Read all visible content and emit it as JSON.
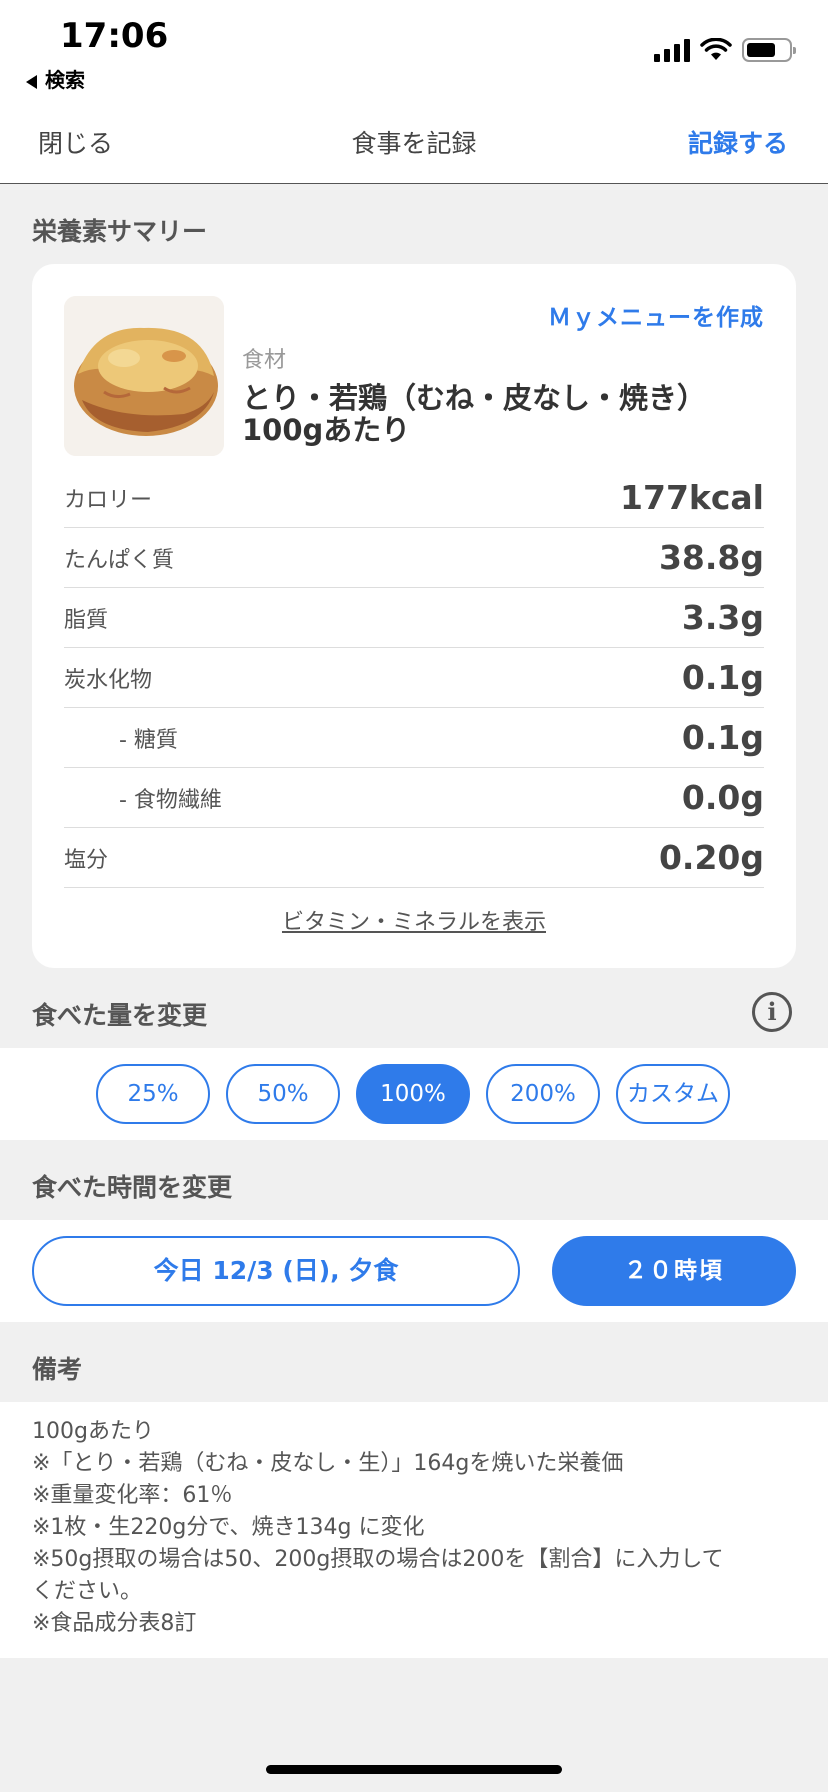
{
  "status_bar": {
    "time": "17:06",
    "back_label": "検索"
  },
  "nav": {
    "close": "閉じる",
    "title": "食事を記録",
    "record": "記録する"
  },
  "summary": {
    "section_title": "栄養素サマリー",
    "my_menu_link": "Ｍｙメニューを作成",
    "category": "食材",
    "food_name_line1": "とり・若鶏（むね・皮なし・焼き）",
    "food_name_line2": "100gあたり",
    "rows": [
      {
        "label": "カロリー",
        "value": "177kcal"
      },
      {
        "label": "たんぱく質",
        "value": "38.8g"
      },
      {
        "label": "脂質",
        "value": "3.3g"
      },
      {
        "label": "炭水化物",
        "value": "0.1g"
      },
      {
        "label": "- 糖質",
        "value": "0.1g"
      },
      {
        "label": "- 食物繊維",
        "value": "0.0g"
      },
      {
        "label": "塩分",
        "value": "0.20g"
      }
    ],
    "vitamin_link": "ビタミン・ミネラルを表示"
  },
  "amount": {
    "section_title": "食べた量を変更",
    "options": [
      "25%",
      "50%",
      "100%",
      "200%",
      "カスタム"
    ],
    "selected": "100%"
  },
  "time": {
    "section_title": "食べた時間を変更",
    "date": "今日 12/3 (日), 夕食",
    "hour": "２０時頃"
  },
  "notes": {
    "section_title": "備考",
    "lines": [
      "100gあたり",
      "※「とり・若鶏（むね・皮なし・生）」164gを焼いた栄養価",
      "※重量変化率：61％",
      "※1枚・生220g分で、焼き134g に変化",
      "※50g摂取の場合は50、200g摂取の場合は200を【割合】に入力して",
      "ください。",
      "※食品成分表8訂"
    ]
  },
  "colors": {
    "accent": "#2f7bea",
    "background": "#f0f0f0"
  }
}
